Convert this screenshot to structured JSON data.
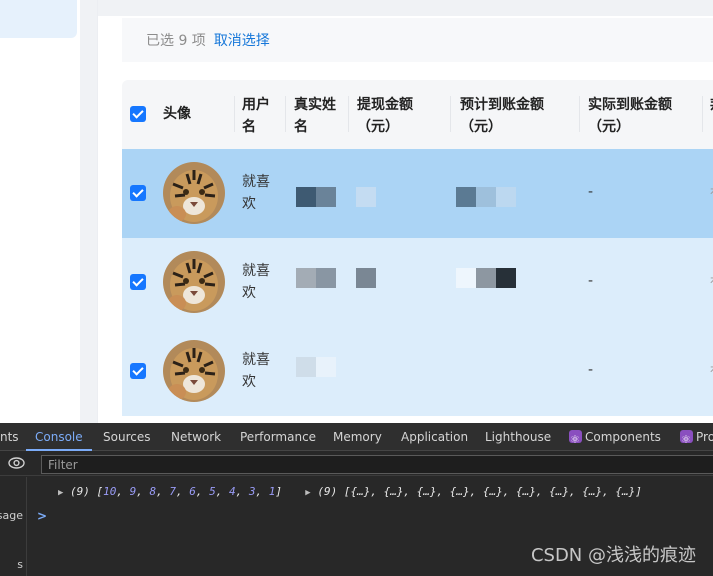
{
  "selection": {
    "count_text": "已选 9 项",
    "cancel_label": "取消选择"
  },
  "table": {
    "headers": {
      "avatar": "头像",
      "username_1": "用户",
      "username_2": "名",
      "realname_1": "真实姓",
      "realname_2": "名",
      "withdraw_1": "提现金额",
      "withdraw_2": "（元）",
      "expected_1": "预计到账金额",
      "expected_2": "（元）",
      "actual_1": "实际到账金额",
      "actual_2": "（元）",
      "cut": "邦"
    },
    "rows": [
      {
        "name_1": "就喜",
        "name_2": "欢",
        "actual": "-",
        "cut": "有"
      },
      {
        "name_1": "就喜",
        "name_2": "欢",
        "actual": "-",
        "cut": "有"
      },
      {
        "name_1": "就喜",
        "name_2": "欢",
        "actual": "-",
        "cut": "有"
      }
    ],
    "colors": {
      "selected_row": "#abd4f5",
      "row": "#dcedfb",
      "checkbox": "#1677ff"
    }
  },
  "devtools": {
    "tabs": [
      "nts",
      "Console",
      "Sources",
      "Network",
      "Performance",
      "Memory",
      "Application",
      "Lighthouse",
      "Components",
      "Pro"
    ],
    "active_tab": "Console",
    "filter_placeholder": "Filter",
    "left_pane": [
      "sage",
      "s"
    ],
    "log": {
      "a_prefix": "(9) [",
      "a_nums": [
        "10",
        "9",
        "8",
        "7",
        "6",
        "5",
        "4",
        "3",
        "1"
      ],
      "a_suffix": "]",
      "b": "(9) [{…}, {…}, {…}, {…}, {…}, {…}, {…}, {…}, {…}]"
    },
    "prompt": ">"
  },
  "watermark": "CSDN @浅浅的痕迹"
}
